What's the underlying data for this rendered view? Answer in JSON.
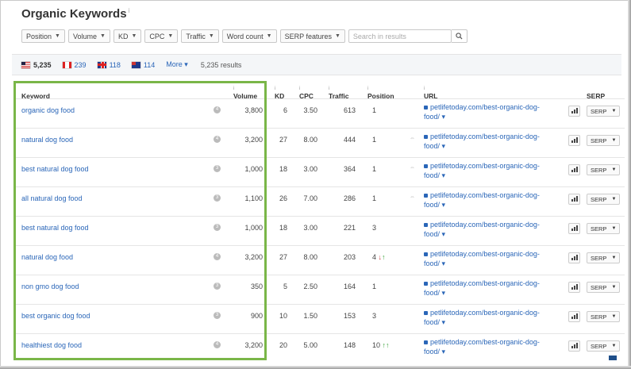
{
  "title": "Organic Keywords",
  "title_info": "i",
  "filters": [
    {
      "label": "Position"
    },
    {
      "label": "Volume"
    },
    {
      "label": "KD"
    },
    {
      "label": "CPC"
    },
    {
      "label": "Traffic"
    },
    {
      "label": "Word count"
    },
    {
      "label": "SERP features"
    }
  ],
  "search_placeholder": "Search in results",
  "countries": [
    {
      "flag": "us",
      "count": "5,235"
    },
    {
      "flag": "ca",
      "count": "239"
    },
    {
      "flag": "gb",
      "count": "118"
    },
    {
      "flag": "au",
      "count": "114"
    }
  ],
  "more_label": "More ▾",
  "results_label": "5,235 results",
  "columns": {
    "keyword": "Keyword",
    "volume": "Volume",
    "kd": "KD",
    "cpc": "CPC",
    "traffic": "Traffic",
    "position": "Position",
    "url": "URL",
    "serp": "SERP"
  },
  "rows": [
    {
      "keyword": "organic dog food",
      "info": "4",
      "volume": "3,800",
      "kd": "6",
      "cpc": "3.50",
      "traffic": "613",
      "position": "1",
      "change_down": "",
      "change_up": "",
      "link_icon": "",
      "url1": "petlifetoday.com/best-organic-dog-",
      "url2": "food/ ▾",
      "serp": "SERP"
    },
    {
      "keyword": "natural dog food",
      "info": "4",
      "volume": "3,200",
      "kd": "27",
      "cpc": "8.00",
      "traffic": "444",
      "position": "1",
      "change_down": "",
      "change_up": "",
      "link_icon": "⇔",
      "url1": "petlifetoday.com/best-organic-dog-",
      "url2": "food/ ▾",
      "serp": "SERP"
    },
    {
      "keyword": "best natural dog food",
      "info": "3",
      "volume": "1,000",
      "kd": "18",
      "cpc": "3.00",
      "traffic": "364",
      "position": "1",
      "change_down": "",
      "change_up": "",
      "link_icon": "⇔",
      "url1": "petlifetoday.com/best-organic-dog-",
      "url2": "food/ ▾",
      "serp": "SERP"
    },
    {
      "keyword": "all natural dog food",
      "info": "3",
      "volume": "1,100",
      "kd": "26",
      "cpc": "7.00",
      "traffic": "286",
      "position": "1",
      "change_down": "",
      "change_up": "",
      "link_icon": "⇔",
      "url1": "petlifetoday.com/best-organic-dog-",
      "url2": "food/ ▾",
      "serp": "SERP"
    },
    {
      "keyword": "best natural dog food",
      "info": "3",
      "volume": "1,000",
      "kd": "18",
      "cpc": "3.00",
      "traffic": "221",
      "position": "3",
      "change_down": "",
      "change_up": "",
      "link_icon": "",
      "url1": "petlifetoday.com/best-organic-dog-",
      "url2": "food/ ▾",
      "serp": "SERP"
    },
    {
      "keyword": "natural dog food",
      "info": "4",
      "volume": "3,200",
      "kd": "27",
      "cpc": "8.00",
      "traffic": "203",
      "position": "4",
      "change_down": "↓",
      "change_up": "↑",
      "link_icon": "",
      "url1": "petlifetoday.com/best-organic-dog-",
      "url2": "food/ ▾",
      "serp": "SERP"
    },
    {
      "keyword": "non gmo dog food",
      "info": "3",
      "volume": "350",
      "kd": "5",
      "cpc": "2.50",
      "traffic": "164",
      "position": "1",
      "change_down": "",
      "change_up": "",
      "link_icon": "",
      "url1": "petlifetoday.com/best-organic-dog-",
      "url2": "food/ ▾",
      "serp": "SERP"
    },
    {
      "keyword": "best organic dog food",
      "info": "3",
      "volume": "900",
      "kd": "10",
      "cpc": "1.50",
      "traffic": "153",
      "position": "3",
      "change_down": "",
      "change_up": "",
      "link_icon": "",
      "url1": "petlifetoday.com/best-organic-dog-",
      "url2": "food/ ▾",
      "serp": "SERP"
    },
    {
      "keyword": "healthiest dog food",
      "info": "4",
      "volume": "3,200",
      "kd": "20",
      "cpc": "5.00",
      "traffic": "148",
      "position": "10",
      "change_down": "",
      "change_up": "↑↑",
      "link_icon": "",
      "url1": "petlifetoday.com/best-organic-dog-",
      "url2": "food/ ▾",
      "serp": "SERP"
    }
  ],
  "colors": {
    "link": "#2a66b8",
    "highlight": "#7ab648",
    "down": "#d04040",
    "up": "#3da33d"
  }
}
